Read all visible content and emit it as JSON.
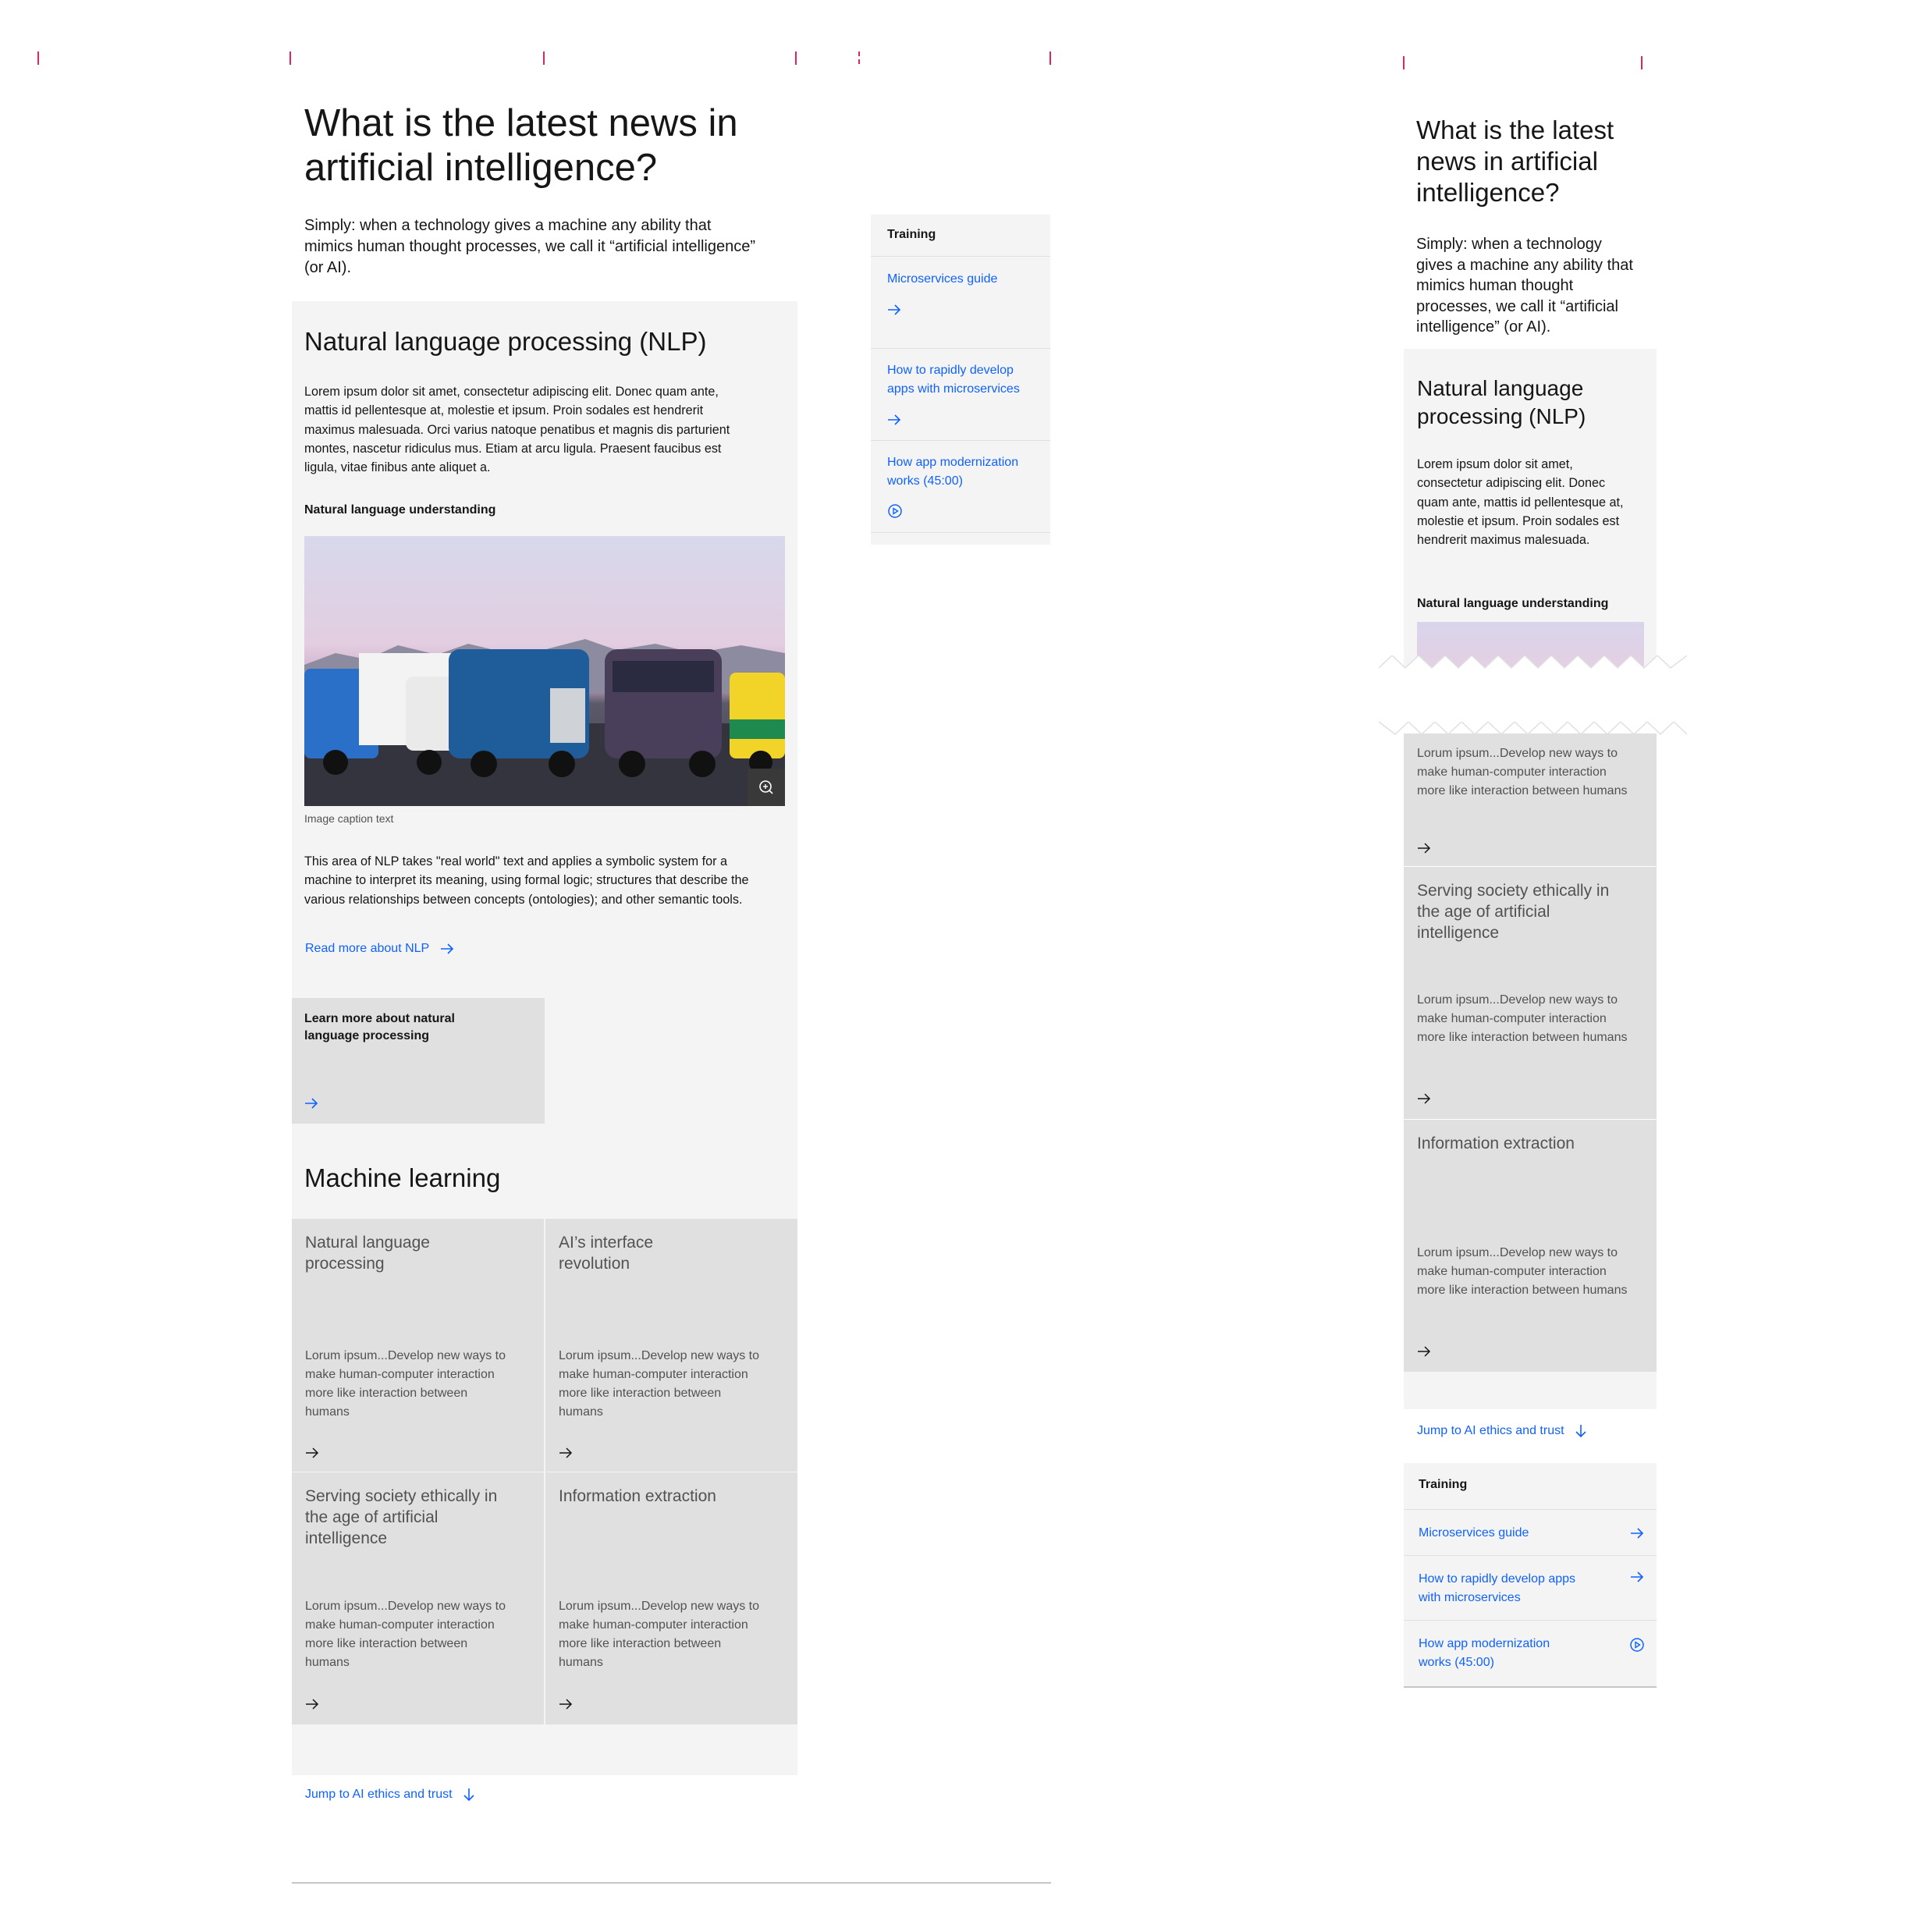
{
  "left": {
    "title": "What is the latest news in artificial intelligence?",
    "lead": "Simply: when a technology gives a machine any ability that mimics human thought processes, we call it “artificial intelligence” (or AI).",
    "nlp": {
      "heading": "Natural language processing (NLP)",
      "body": "Lorem ipsum dolor sit amet, consectetur adipiscing elit. Donec quam ante, mattis id pellentesque at, molestie et ipsum. Proin sodales est hendrerit maximus malesuada. Orci varius natoque penatibus et magnis dis parturient montes, nascetur ridiculus mus. Etiam at arcu ligula. Praesent faucibus est ligula, vitae finibus ante aliquet a.",
      "subheading": "Natural language understanding",
      "caption": "Image caption text",
      "body2": "This area of NLP takes \"real world\" text and applies a symbolic system for a machine to interpret its meaning, using formal logic; structures that describe the various relationships between concepts (ontologies); and other semantic tools.",
      "read_more": "Read more about NLP",
      "learn_more_card": "Learn more about natural language processing"
    },
    "ml": {
      "heading": "Machine learning",
      "cards": [
        {
          "title": "Natural language processing",
          "body": "Lorum ipsum...Develop new ways to make human-computer interaction more like interaction between humans"
        },
        {
          "title": "AI’s interface revolution",
          "body": "Lorum ipsum...Develop new ways to make human-computer interaction more like interaction between humans"
        },
        {
          "title": "Serving society ethically in the age of artificial intelligence",
          "body": "Lorum ipsum...Develop new ways to make human-computer interaction more like interaction between humans"
        },
        {
          "title": "Information extraction",
          "body": "Lorum ipsum...Develop new ways to make human-computer interaction more like interaction between humans"
        }
      ]
    },
    "jump": "Jump to AI ethics and trust"
  },
  "sidebar": {
    "title": "Training",
    "items": [
      {
        "label": "Microservices guide",
        "icon": "arrow-right-icon"
      },
      {
        "label": "How to rapidly develop apps with microservices",
        "icon": "arrow-right-icon"
      },
      {
        "label": "How app modernization works (45:00)",
        "icon": "play-icon"
      }
    ]
  },
  "right": {
    "title": "What is the latest news in artificial intelligence?",
    "lead": "Simply: when a technology gives a machine any ability that mimics human thought processes, we call it “artificial intelligence” (or AI).",
    "nlp_heading": "Natural language processing (NLP)",
    "nlp_body": "Lorem ipsum dolor sit amet, consectetur adipiscing elit. Donec quam ante, mattis id pellentesque at, molestie et ipsum. Proin sodales est hendrerit maximus malesuada.",
    "nlp_subheading": "Natural language understanding",
    "card0_body": "Lorum ipsum...Develop new ways to make human-computer interaction more like interaction between humans",
    "cards": [
      {
        "title": "Serving society ethically in the age of artificial intelligence",
        "body": "Lorum ipsum...Develop new ways to make human-computer interaction more like interaction between humans"
      },
      {
        "title": "Information extraction",
        "body": "Lorum ipsum...Develop new ways to make human-computer interaction more like interaction between humans"
      }
    ],
    "jump": "Jump to AI ethics and trust",
    "training_title": "Training",
    "training_items": [
      {
        "label": "Microservices guide",
        "icon": "arrow-right-icon"
      },
      {
        "label": "How to rapidly develop apps with microservices",
        "icon": "arrow-right-icon"
      },
      {
        "label": "How app modernization works (45:00)",
        "icon": "play-icon"
      }
    ]
  },
  "colors": {
    "link": "#0f62fe",
    "panel": "#f4f4f4",
    "card": "#e0e0e0",
    "tick": "#e0245e"
  }
}
